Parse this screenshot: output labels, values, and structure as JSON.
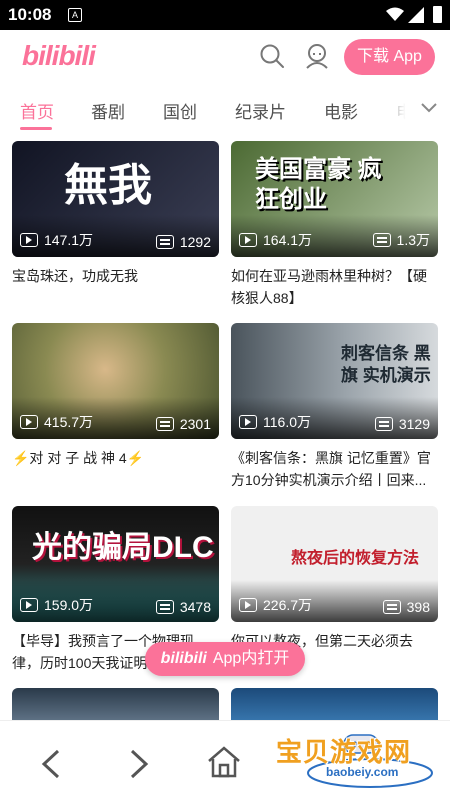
{
  "status_bar": {
    "time": "10:08",
    "notification": "A"
  },
  "header": {
    "logo": "bilibili",
    "download_label": "下载 App"
  },
  "tabs": [
    {
      "label": "首页",
      "active": true
    },
    {
      "label": "番剧"
    },
    {
      "label": "国创"
    },
    {
      "label": "纪录片"
    },
    {
      "label": "电影"
    },
    {
      "label": "电"
    }
  ],
  "videos": [
    {
      "thumb_text": "無我",
      "views": "147.1万",
      "danmaku": "1292",
      "title": "宝岛珠还，功成无我",
      "colors": [
        "#1a1d2e",
        "#3b3f55"
      ]
    },
    {
      "thumb_text": "美国富豪 疯狂创业",
      "views": "164.1万",
      "danmaku": "1.3万",
      "title": "如何在亚马逊雨林里种树？【硬核狠人88】",
      "colors": [
        "#5d7b3a",
        "#b7c9a8"
      ]
    },
    {
      "thumb_text": "",
      "views": "415.7万",
      "danmaku": "2301",
      "title": "⚡对 对 子 战 神 4⚡",
      "colors": [
        "#6f7a45",
        "#c6b08a"
      ]
    },
    {
      "thumb_text": "刺客信条 黑旗 实机演示",
      "views": "116.0万",
      "danmaku": "3129",
      "title": "《刺客信条：黑旗 记忆重置》官方10分钟实机演示介绍丨回来...",
      "colors": [
        "#5a6670",
        "#c7ccd0"
      ]
    },
    {
      "thumb_text": "光的骗局DLC",
      "views": "159.0万",
      "danmaku": "3478",
      "title": "【毕导】我预言了一个物理现律，历时100天我证明...",
      "colors": [
        "#1b1b1b",
        "#3aa6a6"
      ]
    },
    {
      "thumb_text": "熬夜后的恢复方法",
      "views": "226.7万",
      "danmaku": "398",
      "title": "你可以熬夜，但第二天必须去做...",
      "colors": [
        "#f2f2f2",
        "#e8e8e8"
      ]
    },
    {
      "thumb_text": "",
      "views": "",
      "danmaku": "",
      "title": "",
      "colors": [
        "#2a3a4a",
        "#6a7e92"
      ]
    },
    {
      "thumb_text": "",
      "views": "",
      "danmaku": "",
      "title": "",
      "colors": [
        "#1c4a7a",
        "#3d7fb8"
      ]
    }
  ],
  "floating_button": {
    "logo": "bilibili",
    "label": "App内打开"
  },
  "watermark": {
    "title": "宝贝游戏网",
    "url": "baobeiy.com"
  },
  "accent": "#fb7299"
}
